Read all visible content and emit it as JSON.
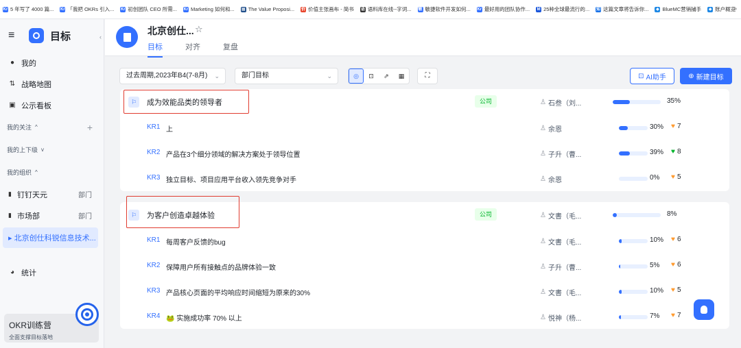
{
  "bookmarks": [
    {
      "icon": "Kr",
      "color": "#3370ff",
      "label": "5 年写了 4000 篇..."
    },
    {
      "icon": "Kr",
      "color": "#3370ff",
      "label": "「我把 OKRs 引入..."
    },
    {
      "icon": "Kr",
      "color": "#3370ff",
      "label": "初创团队 CEO 所需..."
    },
    {
      "icon": "Kr",
      "color": "#3370ff",
      "label": "Marketing 如何和..."
    },
    {
      "icon": "▦",
      "color": "#1f4e8a",
      "label": "The Value Proposi..."
    },
    {
      "icon": "价",
      "color": "#e8452c",
      "label": "价值主张画布 - 简书"
    },
    {
      "icon": "语",
      "color": "#333333",
      "label": "语料库在线--字词..."
    },
    {
      "icon": "敏",
      "color": "#3370ff",
      "label": "敏捷软件开发如何..."
    },
    {
      "icon": "Kr",
      "color": "#3370ff",
      "label": "最好用的团队协作..."
    },
    {
      "icon": "M",
      "color": "#1a56db",
      "label": "25种全球最流行的..."
    },
    {
      "icon": "知",
      "color": "#1a73e8",
      "label": "这篇文章将告诉你..."
    },
    {
      "icon": "◆",
      "color": "#1e88e5",
      "label": "BlueMC营销捕手"
    },
    {
      "icon": "◆",
      "color": "#1e88e5",
      "label": "账户概览"
    }
  ],
  "bookmarks_more": "»",
  "sidebar": {
    "title": "目标",
    "nav": [
      {
        "icon": "person-icon",
        "glyph": "●",
        "label": "我的"
      },
      {
        "icon": "strategy-map-icon",
        "glyph": "⇅",
        "label": "战略地图"
      },
      {
        "icon": "board-icon",
        "glyph": "▣",
        "label": "公示看板"
      }
    ],
    "following_label": "我的关注",
    "following_caret": "^",
    "following_add": "+",
    "updown_label": "我的上下级",
    "updown_caret": "v",
    "org_label": "我的组织",
    "org_caret": "^",
    "orgs": [
      {
        "label": "钉钉天元",
        "dept": "部门"
      },
      {
        "label": "市场部",
        "dept": "部门"
      }
    ],
    "active_org": "▸ 北京创仕科锐信息技术...",
    "stats_label": "统计",
    "promo_title": "OKR训练营",
    "promo_sub": "全面支撑目标落地"
  },
  "header": {
    "org_name": "北京创仕...",
    "star": "☆",
    "tabs": [
      "目标",
      "对齐",
      "复盘"
    ],
    "active_tab": 0
  },
  "toolbar": {
    "period": "过去周期,2023年B4(7-8月)",
    "scope": "部门目标",
    "view_icons": [
      "◎",
      "⊡",
      "⇗",
      "▦"
    ],
    "expand": "⛶",
    "ai_label": "AI助手",
    "new_label": "新建目标",
    "new_icon": "⊕"
  },
  "objectives": [
    {
      "title": "成为效能品类的领导者",
      "tag": "公司",
      "owner": "石叁（刘...",
      "progress": 35,
      "progress_label": "35%",
      "krs": [
        {
          "code": "KR1",
          "text": "上",
          "owner": "余恩",
          "progress": 30,
          "progress_label": "30%",
          "heart_color": "#ff9a2e",
          "score": "7"
        },
        {
          "code": "KR2",
          "text": "产品在3个细分领域的解决方案处于领导位置",
          "owner": "子升（曹...",
          "progress": 39,
          "progress_label": "39%",
          "heart_color": "#00b42a",
          "score": "8"
        },
        {
          "code": "KR3",
          "text": "独立目标、项目应用平台收入领先竞争对手",
          "owner": "余恩",
          "progress": 0,
          "progress_label": "0%",
          "heart_color": "#ff9a2e",
          "score": "5"
        }
      ]
    },
    {
      "title": "为客户创造卓越体验",
      "tag": "公司",
      "owner": "文書（毛...",
      "progress": 8,
      "progress_label": "8%",
      "krs": [
        {
          "code": "KR1",
          "text": "每周客户反馈的bug",
          "owner": "文書（毛...",
          "progress": 10,
          "progress_label": "10%",
          "heart_color": "#ff9a2e",
          "score": "6"
        },
        {
          "code": "KR2",
          "text": "保障用户所有接触点的品牌体验一致",
          "owner": "子升（曹...",
          "progress": 5,
          "progress_label": "5%",
          "heart_color": "#ff9a2e",
          "score": "6"
        },
        {
          "code": "KR3",
          "text": "产品核心页面的平均响应时间缩短为原来的30%",
          "owner": "文書（毛...",
          "progress": 10,
          "progress_label": "10%",
          "heart_color": "#ff9a2e",
          "score": "5"
        },
        {
          "code": "KR4",
          "text": "🐸 实施成功率 70% 以上",
          "owner": "悦神（杨...",
          "progress": 7,
          "progress_label": "7%",
          "heart_color": "#ff9a2e",
          "score": "7"
        }
      ]
    }
  ],
  "colors": {
    "accent": "#3370ff",
    "highlight": "#e03b2f",
    "tag_green": "#00b42a"
  }
}
